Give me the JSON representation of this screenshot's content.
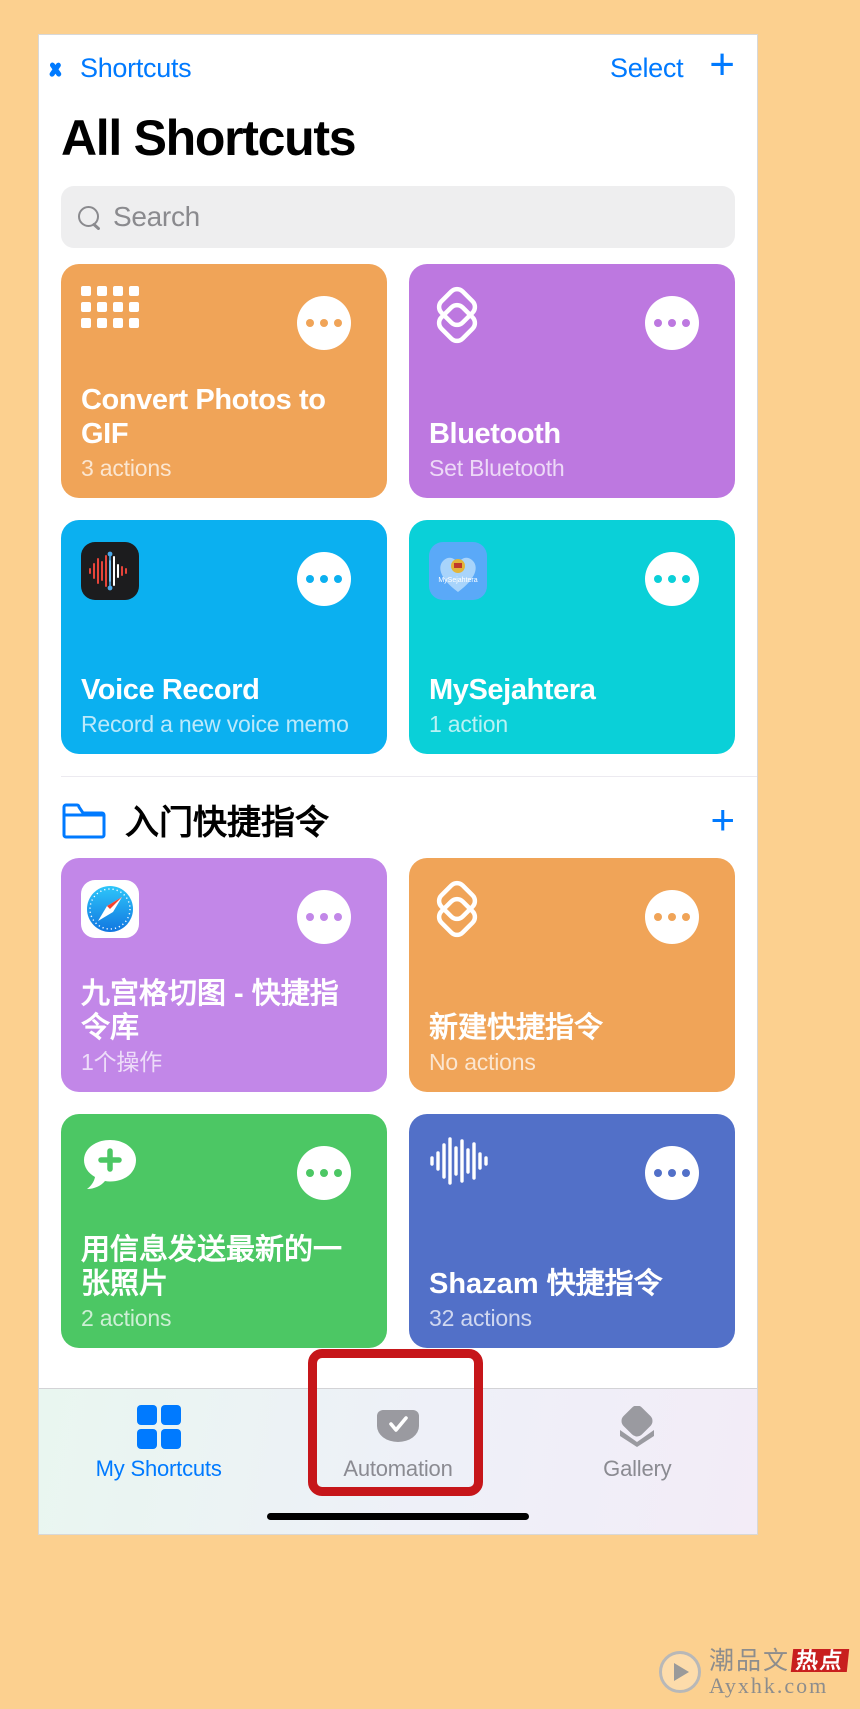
{
  "nav": {
    "back_label": "Shortcuts",
    "select_label": "Select",
    "add_label": "+"
  },
  "page_title": "All Shortcuts",
  "search": {
    "placeholder": "Search",
    "value": "",
    "icon": "search-icon"
  },
  "all_shortcuts": [
    {
      "title": "Convert Photos to GIF",
      "subtitle": "3 actions",
      "color": "#f0a458",
      "icon": "grid-dots-icon"
    },
    {
      "title": "Bluetooth",
      "subtitle": "Set Bluetooth",
      "color": "#bd78e0",
      "icon": "layers-icon"
    },
    {
      "title": "Voice Record",
      "subtitle": "Record a new voice memo",
      "color": "#0bb0f0",
      "icon": "voice-memos-app-icon"
    },
    {
      "title": "MySejahtera",
      "subtitle": "1 action",
      "color": "#0ad0d8",
      "icon": "mysejahtera-app-icon"
    }
  ],
  "folder": {
    "name": "入门快捷指令",
    "icon": "folder-icon",
    "add_label": "+",
    "shortcuts": [
      {
        "title": "九宫格切图 - 快捷指令库",
        "subtitle": "1个操作",
        "color": "#c287e8",
        "icon": "safari-app-icon"
      },
      {
        "title": "新建快捷指令",
        "subtitle": "No actions",
        "color": "#f0a458",
        "icon": "layers-icon"
      },
      {
        "title": "用信息发送最新的一张照片",
        "subtitle": "2 actions",
        "color": "#4cc764",
        "icon": "message-plus-icon"
      },
      {
        "title": "Shazam 快捷指令",
        "subtitle": "32 actions",
        "color": "#5270c8",
        "icon": "waveform-icon"
      }
    ]
  },
  "tabbar": [
    {
      "label": "My Shortcuts",
      "icon": "squares-grid-icon",
      "active": true
    },
    {
      "label": "Automation",
      "icon": "automation-check-icon",
      "active": false
    },
    {
      "label": "Gallery",
      "icon": "gallery-diamond-icon",
      "active": false
    }
  ],
  "annotation": {
    "target": "Automation",
    "color": "#c6161a"
  },
  "watermark": {
    "cn": "潮品文",
    "hot": "热点",
    "url": "Ayxhk.com"
  },
  "colors": {
    "accent": "#007aff",
    "background": "#fcd08f",
    "search_bg": "#eeeeef"
  }
}
